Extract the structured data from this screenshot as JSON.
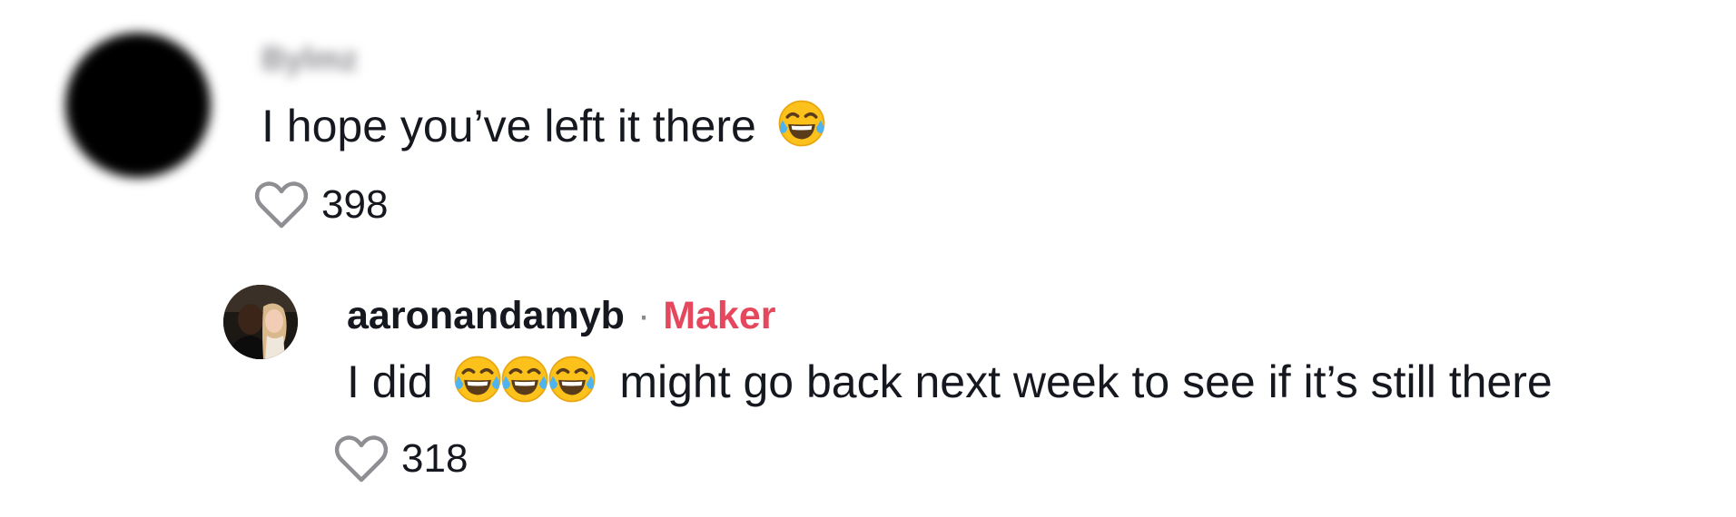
{
  "comments": [
    {
      "username": "Bylmz",
      "text": "I hope you’ve left it there",
      "emoji": [
        "face-with-tears-of-joy"
      ],
      "likes": "398"
    }
  ],
  "reply": {
    "username": "aaronandamyb",
    "separator": "·",
    "badge": "Maker",
    "text_before": "I did",
    "emoji": [
      "face-with-tears-of-joy",
      "face-with-tears-of-joy",
      "face-with-tears-of-joy"
    ],
    "text_after": "might go back next week to see if it’s still there",
    "likes": "318"
  },
  "colors": {
    "text": "#16181f",
    "muted": "#8a8b91",
    "maker_badge": "#e5475c",
    "heart_outline": "#8e8e93"
  },
  "icons": {
    "like": "heart-outline-icon",
    "emoji": "face-with-tears-of-joy"
  }
}
